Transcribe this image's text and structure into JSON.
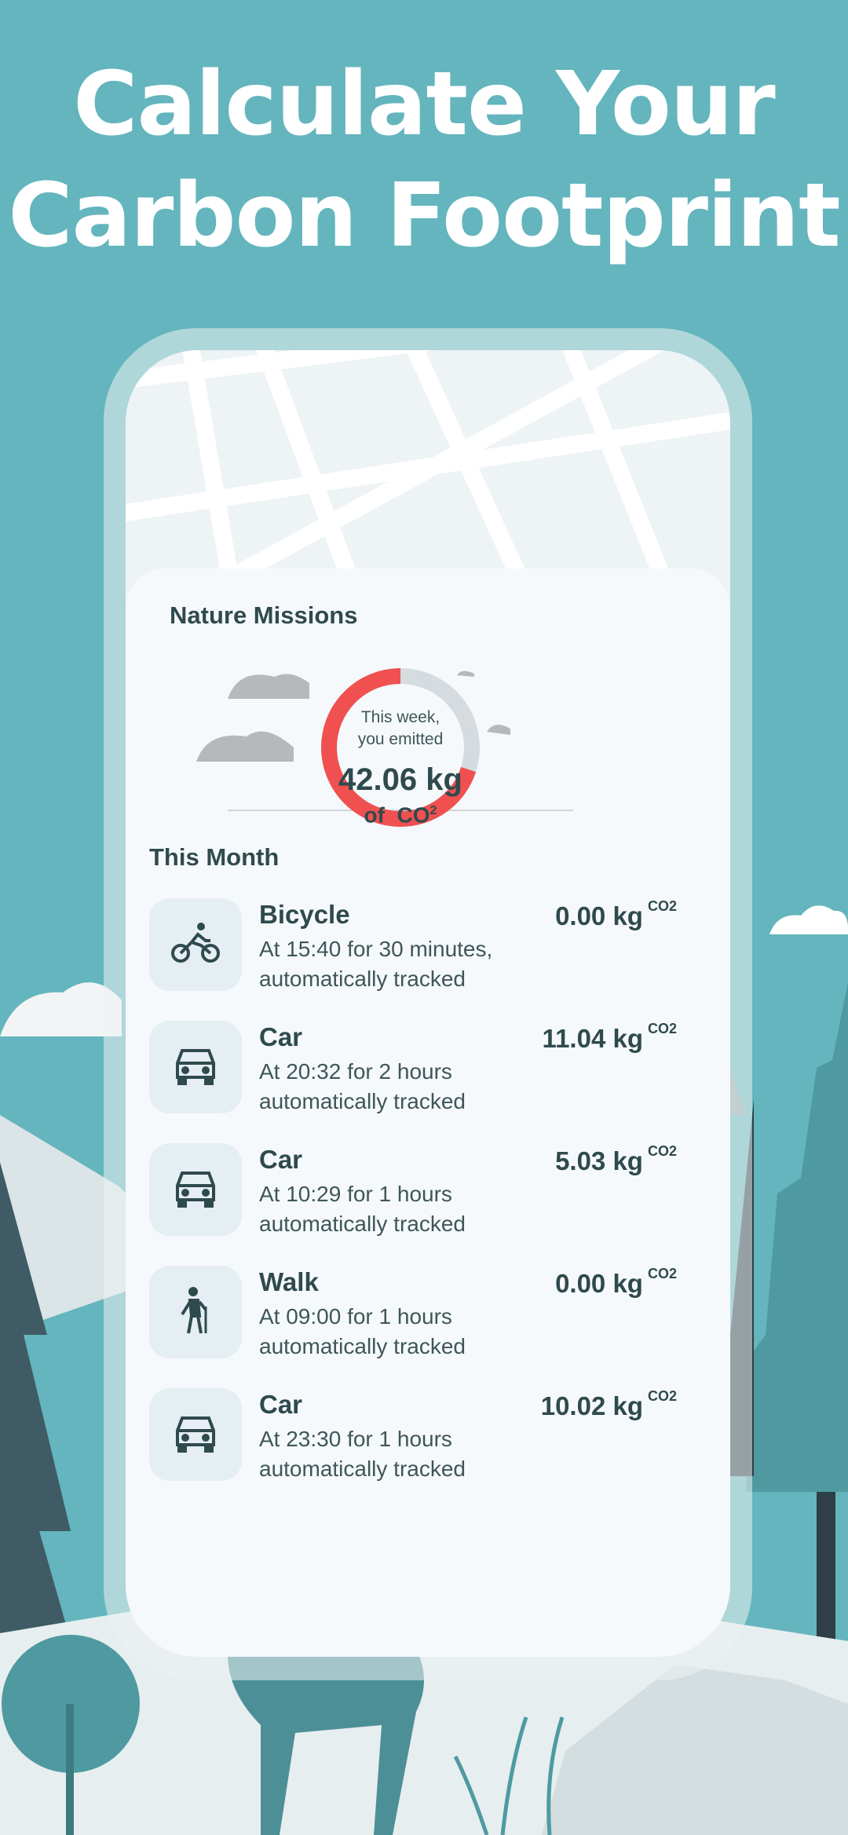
{
  "headline": {
    "line1": "Calculate Your",
    "line2": "Carbon Footprint"
  },
  "missions": {
    "title": "Nature Missions",
    "gauge": {
      "label_line1": "This week,",
      "label_line2": "you emitted",
      "value": "42.06 kg",
      "unit_prefix": "of",
      "unit": "CO",
      "unit_sup": "2",
      "filled_fraction": 0.7,
      "filled_color": "#f05050",
      "track_color": "#d5dbdf"
    }
  },
  "this_month": {
    "title": "This Month",
    "activities": [
      {
        "icon": "bicycle-icon",
        "name": "Bicycle",
        "detail_line1": "At 15:40 for 30 minutes,",
        "detail_line2": "automatically tracked",
        "amount": "0.00 kg",
        "unit": "CO2"
      },
      {
        "icon": "car-icon",
        "name": "Car",
        "detail_line1": "At 20:32 for 2 hours",
        "detail_line2": "automatically tracked",
        "amount": "11.04 kg",
        "unit": "CO2"
      },
      {
        "icon": "car-icon",
        "name": "Car",
        "detail_line1": "At 10:29 for 1 hours",
        "detail_line2": "automatically tracked",
        "amount": "5.03 kg",
        "unit": "CO2"
      },
      {
        "icon": "walk-icon",
        "name": "Walk",
        "detail_line1": "At 09:00 for 1 hours",
        "detail_line2": "automatically tracked",
        "amount": "0.00 kg",
        "unit": "CO2"
      },
      {
        "icon": "car-icon",
        "name": "Car",
        "detail_line1": "At 23:30 for 1 hours",
        "detail_line2": "automatically tracked",
        "amount": "10.02 kg",
        "unit": "CO2"
      }
    ]
  },
  "colors": {
    "background": "#64b5bd",
    "text_dark": "#2f4a4d",
    "accent_red": "#f05050"
  }
}
